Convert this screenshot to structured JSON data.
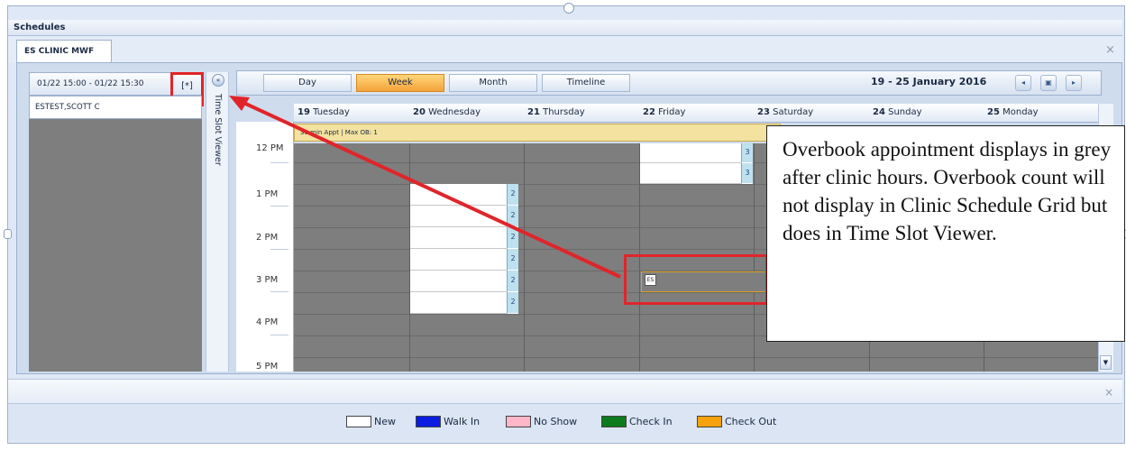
{
  "window": {
    "title": "Schedules"
  },
  "tab": {
    "label": "ES CLINIC MWF",
    "close": "×"
  },
  "slot_panel": {
    "range": "01/22 15:00 - 01/22 15:30",
    "overbook_marker": "[*]",
    "patient": "ESTEST,SCOTT C",
    "viewer_label": "Time Slot Viewer",
    "viewer_button": "«"
  },
  "toolbar": {
    "views": [
      "Day",
      "Week",
      "Month",
      "Timeline"
    ],
    "active_view": "Week",
    "range_label": "19 - 25 January 2016",
    "nav": [
      "◂",
      "▣",
      "▸"
    ]
  },
  "days": [
    {
      "num": "19",
      "name": "Tuesday"
    },
    {
      "num": "20",
      "name": "Wednesday"
    },
    {
      "num": "21",
      "name": "Thursday"
    },
    {
      "num": "22",
      "name": "Friday"
    },
    {
      "num": "23",
      "name": "Saturday"
    },
    {
      "num": "24",
      "name": "Sunday"
    },
    {
      "num": "25",
      "name": "Monday"
    }
  ],
  "allday_banner": "30 min Appt | Max OB: 1",
  "times": [
    "12 PM",
    "1 PM",
    "2 PM",
    "3 PM",
    "4 PM",
    "5 PM"
  ],
  "counts": {
    "friday": [
      "3",
      "3"
    ],
    "wednesday": [
      "2",
      "2",
      "2",
      "2",
      "2",
      "2"
    ]
  },
  "appointment_icon": "ES",
  "callout": "Overbook appointment displays in grey after clinic hours. Overbook count will not display in Clinic Schedule Grid but does in Time Slot Viewer.",
  "legend": [
    {
      "label": "New",
      "color": "#ffffff"
    },
    {
      "label": "Walk In",
      "color": "#0a1de0"
    },
    {
      "label": "No Show",
      "color": "#ffb6c8"
    },
    {
      "label": "Check In",
      "color": "#0e7a1e"
    },
    {
      "label": "Check Out",
      "color": "#f5a20c"
    }
  ],
  "close_glyph": "×"
}
